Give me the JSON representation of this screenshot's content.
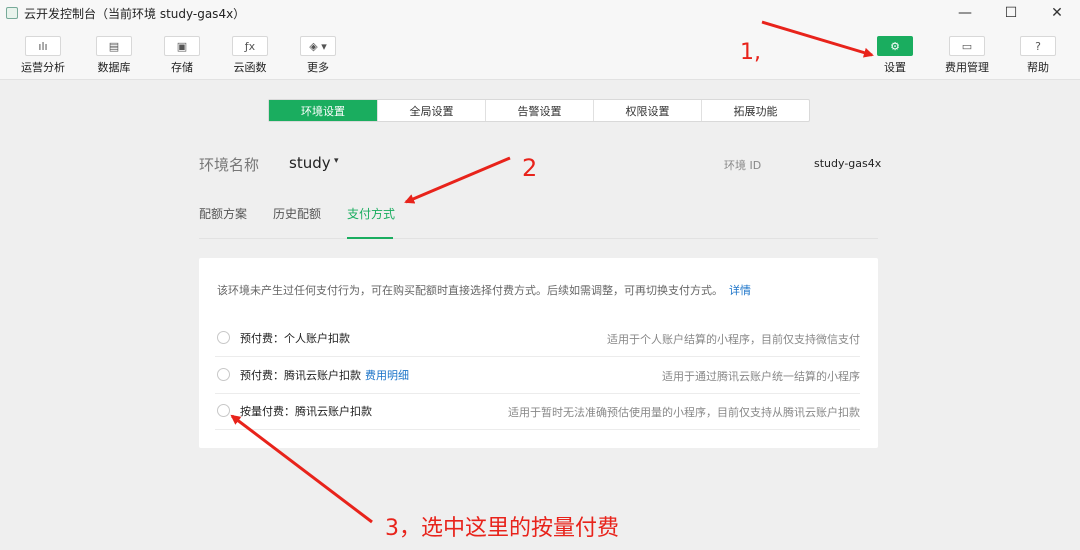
{
  "window": {
    "title": "云开发控制台（当前环境 study-gas4x）",
    "minimize": "—",
    "maximize": "☐",
    "close": "✕"
  },
  "toolbar": {
    "left": [
      {
        "label": "运营分析",
        "icon": "bar-chart-icon",
        "glyph": "ılı"
      },
      {
        "label": "数据库",
        "icon": "database-icon",
        "glyph": "▤"
      },
      {
        "label": "存储",
        "icon": "storage-icon",
        "glyph": "▣"
      },
      {
        "label": "云函数",
        "icon": "function-icon",
        "glyph": "ƒx"
      },
      {
        "label": "更多",
        "icon": "layers-icon",
        "glyph": "◈ ▾"
      }
    ],
    "right": [
      {
        "label": "设置",
        "icon": "gear-icon",
        "glyph": "⚙"
      },
      {
        "label": "费用管理",
        "icon": "billing-icon",
        "glyph": "▭"
      },
      {
        "label": "帮助",
        "icon": "help-icon",
        "glyph": "?"
      }
    ]
  },
  "tabs": [
    "环境设置",
    "全局设置",
    "告警设置",
    "权限设置",
    "拓展功能"
  ],
  "env": {
    "label": "环境名称",
    "name": "study",
    "caret": "▾",
    "id_label": "环境 ID",
    "id_value": "study-gas4x"
  },
  "subtabs": [
    "配额方案",
    "历史配额",
    "支付方式"
  ],
  "panel": {
    "notice": "该环境未产生过任何支付行为，可在购买配额时直接选择付费方式。后续如需调整，可再切换支付方式。",
    "notice_link": "详情",
    "options": [
      {
        "label": "预付费：个人账户扣款",
        "link": "",
        "desc": "适用于个人账户结算的小程序，目前仅支持微信支付"
      },
      {
        "label": "预付费：腾讯云账户扣款",
        "link": "费用明细",
        "desc": "适用于通过腾讯云账户统一结算的小程序"
      },
      {
        "label": "按量付费：腾讯云账户扣款",
        "link": "",
        "desc": "适用于暂时无法准确预估使用量的小程序，目前仅支持从腾讯云账户扣款"
      }
    ]
  },
  "annotations": {
    "step1": "1,",
    "step2": "2",
    "step3": "3，选中这里的按量付费",
    "color": "#e8231b"
  },
  "colors": {
    "accent": "#1aad5f",
    "link": "#1a73c8"
  }
}
